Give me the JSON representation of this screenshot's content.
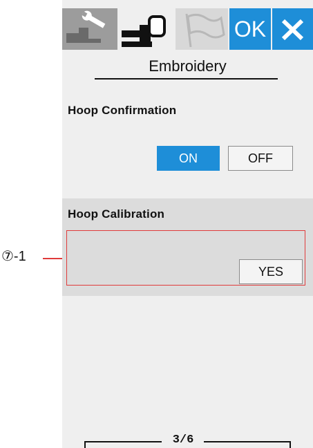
{
  "tabs": [
    {
      "name": "general-settings",
      "icon": "wrench-machine-icon"
    },
    {
      "name": "embroidery-settings",
      "icon": "hoop-machine-icon",
      "active": true
    },
    {
      "name": "language-settings",
      "icon": "flag-icon"
    }
  ],
  "header": {
    "ok_label": "OK",
    "close_icon": "close-icon",
    "accent_color": "#1e8ed8"
  },
  "title": "Embroidery",
  "hoop_confirmation": {
    "label": "Hoop Confirmation",
    "on_label": "ON",
    "off_label": "OFF",
    "selected": "ON"
  },
  "hoop_calibration": {
    "label": "Hoop Calibration",
    "yes_label": "YES"
  },
  "callout": {
    "label": "⑦-1",
    "color": "#e03a3a"
  },
  "pager": {
    "text": "3/6"
  }
}
